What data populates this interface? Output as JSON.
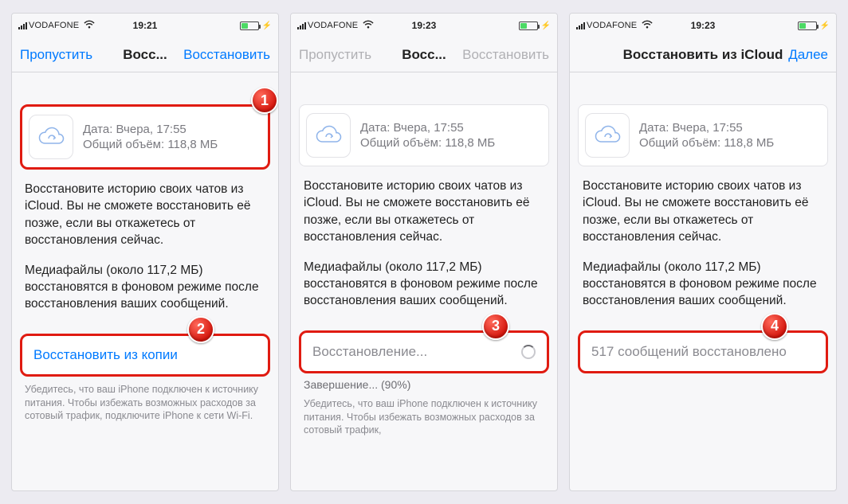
{
  "screens": [
    {
      "status": {
        "carrier": "VODAFONE",
        "time": "19:21"
      },
      "nav": {
        "left": "Пропустить",
        "title": "Восс...",
        "right": "Восстановить",
        "leftDim": false,
        "rightDim": false
      },
      "backup": {
        "line1": "Дата: Вчера, 17:55",
        "line2": "Общий объём: 118,8 МБ",
        "highlight": true
      },
      "body": {
        "p1": "Восстановите историю своих чатов из iCloud. Вы не сможете восстановить её позже, если вы откажетесь от восстановления сейчас.",
        "p2": "Медиафайлы (около 117,2 МБ) восстановятся в фоновом режиме после восстановления ваших сообщений."
      },
      "action": {
        "label": "Восстановить из копии",
        "labelClass": "label-blue",
        "showSpinner": false
      },
      "note": "Убедитесь, что ваш iPhone подключен к источнику питания. Чтобы избежать возможных расходов за сотовый трафик, подключите iPhone к сети Wi-Fi.",
      "progress": "",
      "badges": {
        "backup": "1",
        "action": "2"
      }
    },
    {
      "status": {
        "carrier": "VODAFONE",
        "time": "19:23"
      },
      "nav": {
        "left": "Пропустить",
        "title": "Восс...",
        "right": "Восстановить",
        "leftDim": true,
        "rightDim": true
      },
      "backup": {
        "line1": "Дата: Вчера, 17:55",
        "line2": "Общий объём: 118,8 МБ",
        "highlight": false
      },
      "body": {
        "p1": "Восстановите историю своих чатов из iCloud. Вы не сможете восстановить её позже, если вы откажетесь от восстановления сейчас.",
        "p2": "Медиафайлы (около 117,2 МБ) восстановятся в фоновом режиме после восстановления ваших сообщений."
      },
      "action": {
        "label": "Восстановление...",
        "labelClass": "label-grey",
        "showSpinner": true
      },
      "note": "Убедитесь, что ваш iPhone подключен к источнику питания. Чтобы избежать возможных расходов за сотовый трафик,",
      "progress": "Завершение... (90%)",
      "badges": {
        "backup": "",
        "action": "3"
      }
    },
    {
      "status": {
        "carrier": "VODAFONE",
        "time": "19:23"
      },
      "nav": {
        "left": "",
        "title": "Восстановить из iCloud",
        "right": "Далее",
        "leftDim": false,
        "rightDim": false
      },
      "backup": {
        "line1": "Дата: Вчера, 17:55",
        "line2": "Общий объём: 118,8 МБ",
        "highlight": false
      },
      "body": {
        "p1": "Восстановите историю своих чатов из iCloud. Вы не сможете восстановить её позже, если вы откажетесь от восстановления сейчас.",
        "p2": "Медиафайлы (около 117,2 МБ) восстановятся в фоновом режиме после восстановления ваших сообщений."
      },
      "action": {
        "label": "517 сообщений восстановлено",
        "labelClass": "label-grey",
        "showSpinner": false
      },
      "note": "",
      "progress": "",
      "badges": {
        "backup": "",
        "action": "4"
      }
    }
  ]
}
